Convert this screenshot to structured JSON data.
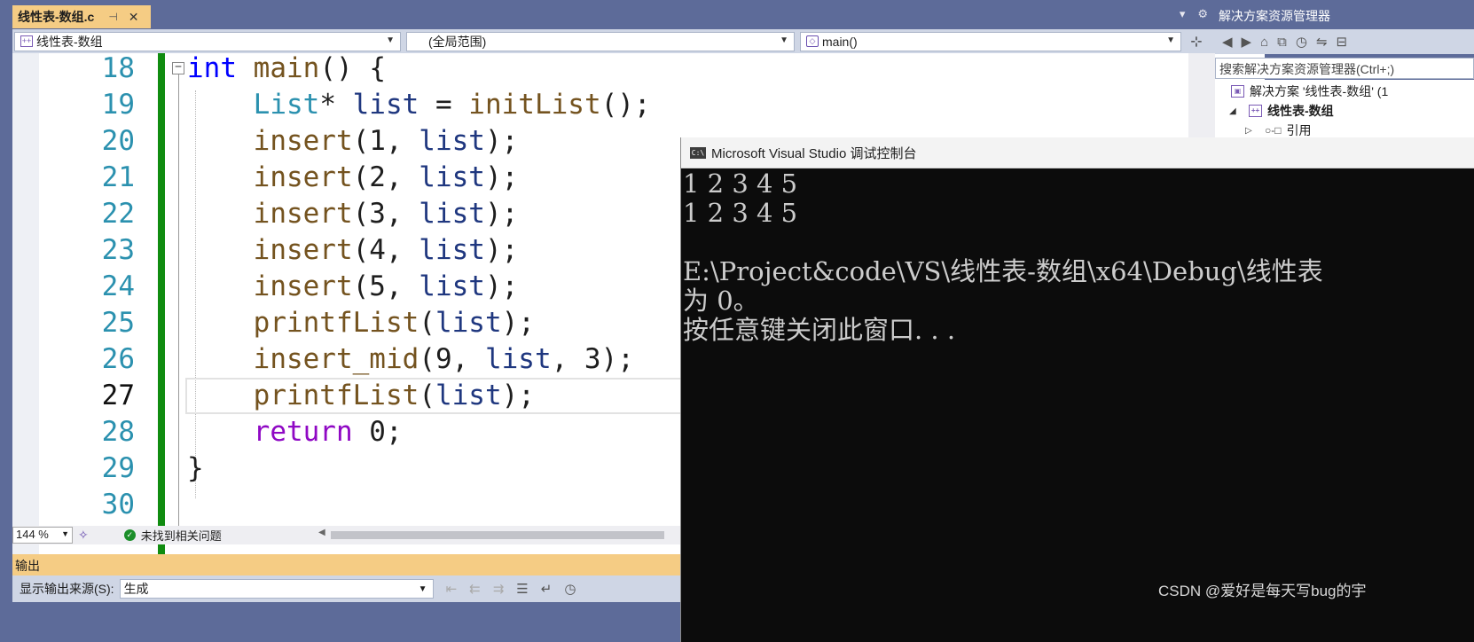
{
  "tab": {
    "title": "线性表-数组.c",
    "pin": "⊣",
    "close": "✕"
  },
  "navbar": {
    "project": "线性表-数组",
    "scope": "(全局范围)",
    "member": "main()"
  },
  "editor": {
    "lines": [
      {
        "num": "18",
        "tokens": [
          {
            "t": "int",
            "c": "kw"
          },
          {
            "t": " "
          },
          {
            "t": "main",
            "c": "fn"
          },
          {
            "t": "() {"
          }
        ]
      },
      {
        "num": "19",
        "tokens": [
          {
            "t": "    "
          },
          {
            "t": "List",
            "c": "ty"
          },
          {
            "t": "* "
          },
          {
            "t": "list",
            "c": "va"
          },
          {
            "t": " = "
          },
          {
            "t": "initList",
            "c": "fn"
          },
          {
            "t": "();"
          }
        ]
      },
      {
        "num": "20",
        "tokens": [
          {
            "t": "    "
          },
          {
            "t": "insert",
            "c": "fn"
          },
          {
            "t": "(1, "
          },
          {
            "t": "list",
            "c": "va"
          },
          {
            "t": ");"
          }
        ]
      },
      {
        "num": "21",
        "tokens": [
          {
            "t": "    "
          },
          {
            "t": "insert",
            "c": "fn"
          },
          {
            "t": "(2, "
          },
          {
            "t": "list",
            "c": "va"
          },
          {
            "t": ");"
          }
        ]
      },
      {
        "num": "22",
        "tokens": [
          {
            "t": "    "
          },
          {
            "t": "insert",
            "c": "fn"
          },
          {
            "t": "(3, "
          },
          {
            "t": "list",
            "c": "va"
          },
          {
            "t": ");"
          }
        ]
      },
      {
        "num": "23",
        "tokens": [
          {
            "t": "    "
          },
          {
            "t": "insert",
            "c": "fn"
          },
          {
            "t": "(4, "
          },
          {
            "t": "list",
            "c": "va"
          },
          {
            "t": ");"
          }
        ]
      },
      {
        "num": "24",
        "tokens": [
          {
            "t": "    "
          },
          {
            "t": "insert",
            "c": "fn"
          },
          {
            "t": "(5, "
          },
          {
            "t": "list",
            "c": "va"
          },
          {
            "t": ");"
          }
        ]
      },
      {
        "num": "25",
        "tokens": [
          {
            "t": "    "
          },
          {
            "t": "printfList",
            "c": "fn"
          },
          {
            "t": "("
          },
          {
            "t": "list",
            "c": "va"
          },
          {
            "t": ");"
          }
        ]
      },
      {
        "num": "26",
        "tokens": [
          {
            "t": "    "
          },
          {
            "t": "insert_mid",
            "c": "fn"
          },
          {
            "t": "(9, "
          },
          {
            "t": "list",
            "c": "va"
          },
          {
            "t": ", 3);"
          }
        ]
      },
      {
        "num": "27",
        "current": true,
        "tokens": [
          {
            "t": "    "
          },
          {
            "t": "printfList",
            "c": "fn"
          },
          {
            "t": "("
          },
          {
            "t": "list",
            "c": "va"
          },
          {
            "t": ");"
          }
        ]
      },
      {
        "num": "28",
        "tokens": [
          {
            "t": "    "
          },
          {
            "t": "return",
            "c": "ctl"
          },
          {
            "t": " 0;"
          }
        ]
      },
      {
        "num": "29",
        "tokens": [
          {
            "t": "}"
          }
        ]
      },
      {
        "num": "30",
        "tokens": []
      }
    ]
  },
  "status": {
    "zoom": "144 %",
    "issues": "未找到相关问题"
  },
  "output": {
    "header": "输出",
    "source_label": "显示输出来源(S):",
    "source_value": "生成"
  },
  "solution_explorer": {
    "title": "解决方案资源管理器",
    "search_placeholder": "搜索解决方案资源管理器(Ctrl+;)",
    "solution": "解决方案 '线性表-数组' (1",
    "project": "线性表-数组",
    "references": "引用"
  },
  "console": {
    "title": "Microsoft Visual Studio 调试控制台",
    "lines": [
      "1 2 3 4 5",
      "1 2 3 4 5",
      "",
      "E:\\Project&code\\VS\\线性表-数组\\x64\\Debug\\线性表",
      "为 0。",
      "按任意键关闭此窗口. . ."
    ]
  },
  "watermark": "CSDN @爱好是每天写bug的宇",
  "colors": {
    "accent_tab": "#f5cc84",
    "chrome": "#5d6b99",
    "change_bar": "#108c10",
    "console_bg": "#0c0c0c"
  }
}
